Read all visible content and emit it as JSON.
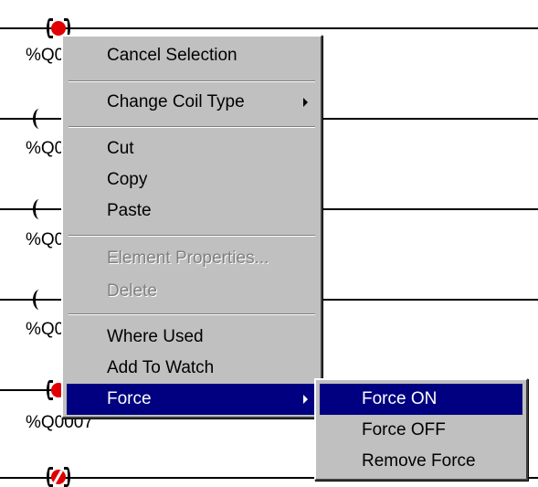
{
  "ladder": {
    "addresses": [
      "%Q0",
      "%Q0",
      "%Q0",
      "%Q0",
      "%Q0007"
    ]
  },
  "context_menu": {
    "items": [
      {
        "label": "Cancel Selection",
        "enabled": true
      },
      {
        "label": "Change Coil Type",
        "enabled": true,
        "submenu": true
      },
      {
        "label": "Cut",
        "enabled": true
      },
      {
        "label": "Copy",
        "enabled": true
      },
      {
        "label": "Paste",
        "enabled": true
      },
      {
        "label": "Element Properties...",
        "enabled": false
      },
      {
        "label": "Delete",
        "enabled": false
      },
      {
        "label": "Where Used",
        "enabled": true
      },
      {
        "label": "Add To Watch",
        "enabled": true
      },
      {
        "label": "Force",
        "enabled": true,
        "submenu": true,
        "highlighted": true
      }
    ]
  },
  "force_submenu": {
    "items": [
      {
        "label": "Force ON",
        "highlighted": true
      },
      {
        "label": "Force OFF"
      },
      {
        "label": "Remove Force"
      }
    ]
  },
  "colors": {
    "menu_face": "#c0c0c0",
    "highlight": "#000080",
    "forced_coil": "#e00000"
  }
}
